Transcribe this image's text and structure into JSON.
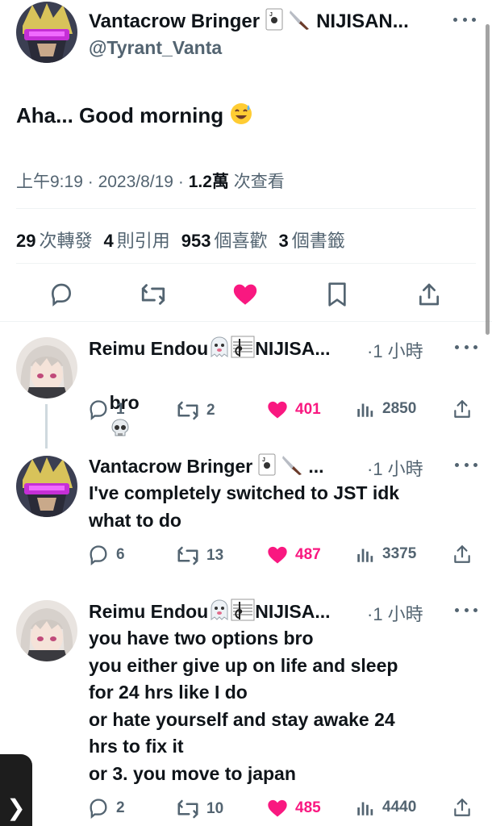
{
  "main_tweet": {
    "display_name": "Vantacrow Bringer",
    "name_suffix": "NIJISAN...",
    "handle": "@Tyrant_Vanta",
    "text": "Aha... Good morning",
    "time": "上午9:19",
    "date": "2023/8/19",
    "views_count": "1.2萬",
    "views_label": "次查看",
    "separator": "·",
    "retweets_count": "29",
    "retweets_label": "次轉發",
    "quotes_count": "4",
    "quotes_label": "則引用",
    "likes_count": "953",
    "likes_label": "個喜歡",
    "bookmarks_count": "3",
    "bookmarks_label": "個書籤"
  },
  "replies": [
    {
      "display_name": "Reimu Endou",
      "name_suffix": "NIJISA...",
      "time": "·1 小時",
      "text_line1": "bro",
      "text": "bro",
      "reply_count": "1",
      "retweet_count": "2",
      "like_count": "401",
      "view_count": "2850"
    },
    {
      "display_name": "Vantacrow Bringer",
      "name_suffix": "...",
      "time": "·1 小時",
      "text": "I've completely switched to JST idk\nwhat to do",
      "reply_count": "6",
      "retweet_count": "13",
      "like_count": "487",
      "view_count": "3375"
    },
    {
      "display_name": "Reimu Endou",
      "name_suffix": "NIJISA...",
      "time": "·1 小時",
      "text": "you have two options bro\nyou either give up on life and sleep\nfor 24 hrs like I do\nor hate yourself and stay awake 24\nhrs to fix it\nor 3. you move to japan",
      "reply_count": "2",
      "retweet_count": "10",
      "like_count": "485",
      "view_count": "4440"
    }
  ],
  "colors": {
    "like_pink": "#f91880",
    "text_primary": "#0f1419",
    "text_secondary": "#536471",
    "divider": "#eff3f4"
  },
  "icons": {
    "reply": "reply-icon",
    "retweet": "retweet-icon",
    "like": "heart-icon",
    "bookmark": "bookmark-icon",
    "share": "share-icon",
    "views": "views-icon",
    "more": "more-icon"
  },
  "edge_tab_glyph": "❯"
}
